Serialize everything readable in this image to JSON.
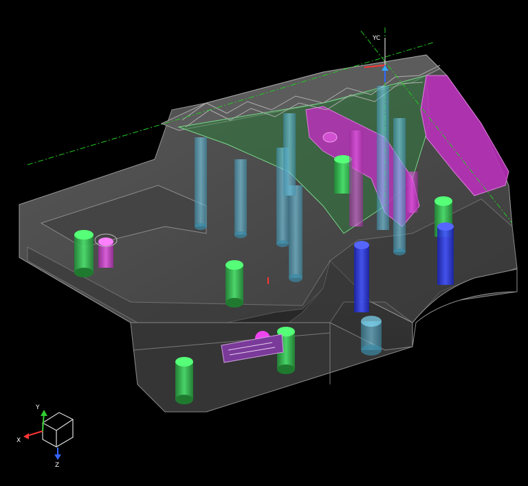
{
  "viewport": {
    "background": "#000000",
    "part_color": "#4a4a4a",
    "edge_color": "#9a9a9a",
    "highlight_green": "#2f6e3a",
    "highlight_magenta": "#b52fb5"
  },
  "work_csys": {
    "label": "YC",
    "datum_line_color": "#22cc22"
  },
  "triad": {
    "x_label": "X",
    "y_label": "Y",
    "z_label": "Z",
    "x_color": "#ff3333",
    "y_color": "#33cc33",
    "z_color": "#3366ff"
  },
  "pins": {
    "colors": {
      "green": "#33dd55",
      "magenta": "#ee44ee",
      "cyan": "#55ccee",
      "blue": "#3344ee"
    }
  }
}
